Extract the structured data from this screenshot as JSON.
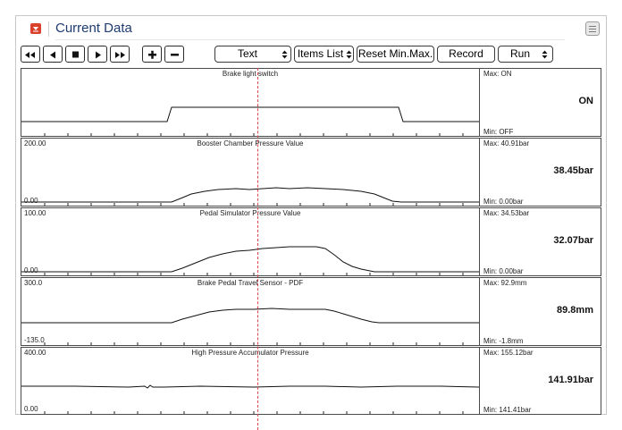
{
  "window": {
    "title": "Current Data"
  },
  "toolbar": {
    "display_mode": "Text",
    "items_list": "Items List",
    "reset": "Reset Min.Max.",
    "record": "Record",
    "run": "Run"
  },
  "colors": {
    "trace": "#111111",
    "cursor": "#d9434b",
    "title": "#1f3b70",
    "collapse": "#d9412b"
  },
  "panels": [
    {
      "title": "Brake light switch",
      "ymax": "",
      "ymin": "",
      "max": "Max: ON",
      "min": "Min:  OFF",
      "current": "ON"
    },
    {
      "title": "Booster Chamber Pressure Value",
      "ymax": "200.00",
      "ymin": "0.00",
      "max": "Max: 40.91bar",
      "min": "Min:  0.00bar",
      "current": "38.45bar"
    },
    {
      "title": "Pedal Simulator Pressure Value",
      "ymax": "100.00",
      "ymin": "0.00",
      "max": "Max: 34.53bar",
      "min": "Min:  0.00bar",
      "current": "32.07bar"
    },
    {
      "title": "Brake Pedal Travel Sensor - PDF",
      "ymax": "300.0",
      "ymin": "-135.0",
      "max": "Max:  92.9mm",
      "min": "Min:  -1.8mm",
      "current": "89.8mm"
    },
    {
      "title": "High Pressure Accumulator Pressure",
      "ymax": "400.00",
      "ymin": "0.00",
      "max": "Max: 155.12bar",
      "min": "Min: 141.41bar",
      "current": "141.91bar"
    }
  ]
}
